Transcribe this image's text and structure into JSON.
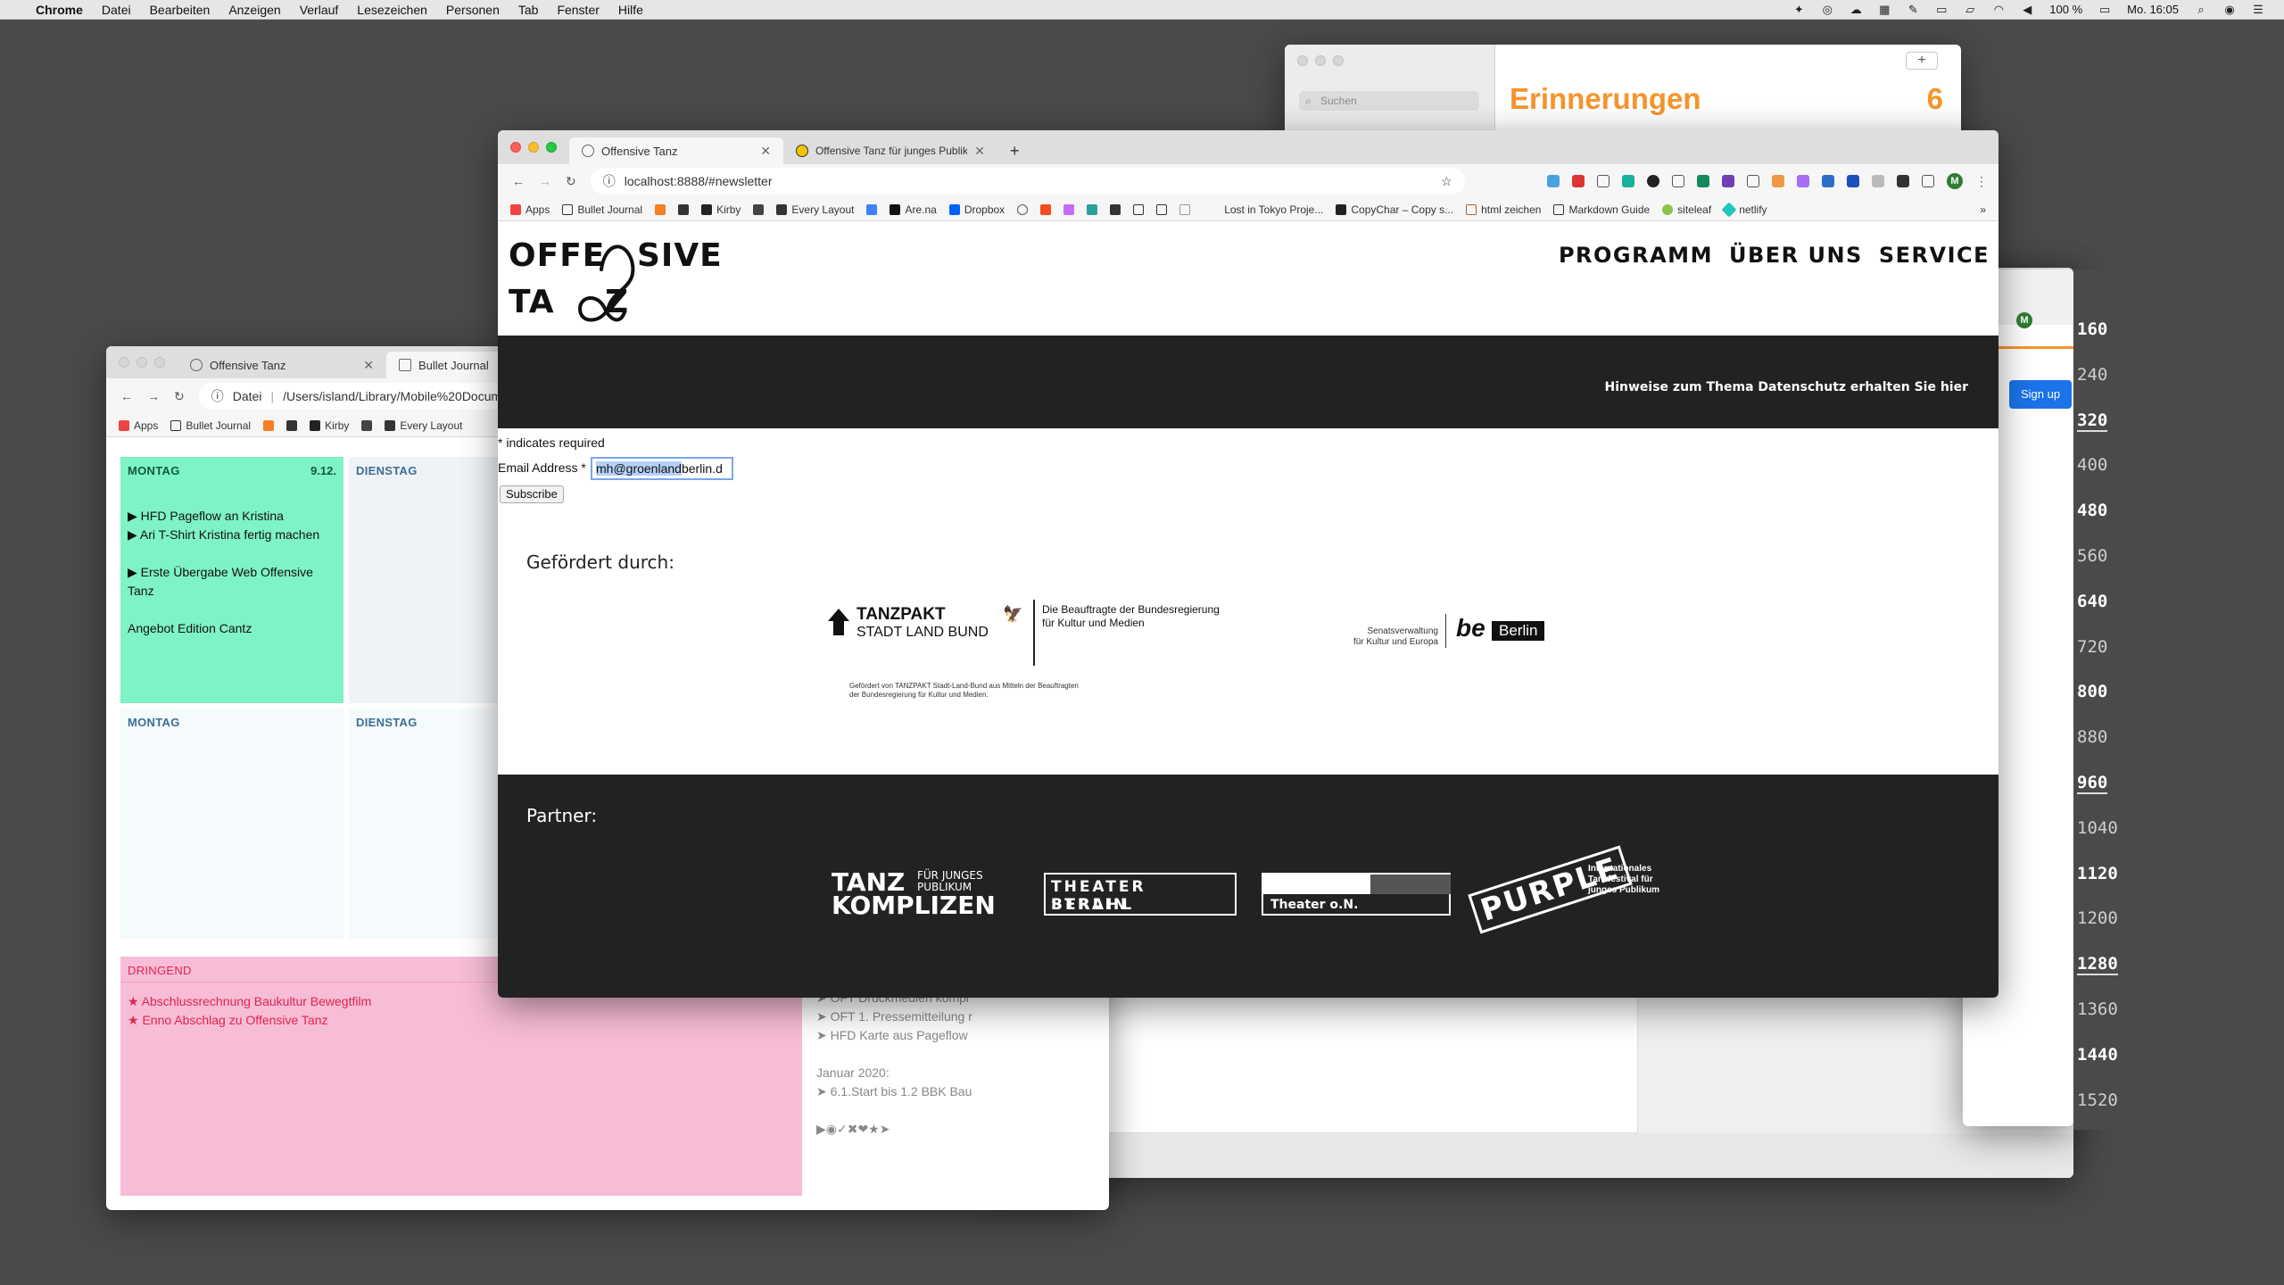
{
  "menubar": {
    "app": "Chrome",
    "items": [
      "Datei",
      "Bearbeiten",
      "Anzeigen",
      "Verlauf",
      "Lesezeichen",
      "Personen",
      "Tab",
      "Fenster",
      "Hilfe"
    ],
    "battery": "100 %",
    "clock": "Mo. 16:05"
  },
  "reminders": {
    "search_placeholder": "Suchen",
    "title": "Erinnerungen",
    "count": "6",
    "add_label": "+"
  },
  "ruler": {
    "values": [
      "160",
      "240",
      "320",
      "400",
      "480",
      "560",
      "640",
      "720",
      "800",
      "880",
      "960",
      "1040",
      "1120",
      "1200",
      "1280",
      "1360",
      "1440",
      "1520"
    ]
  },
  "signup": {
    "label": "Sign up"
  },
  "bj_window": {
    "tabs": [
      {
        "label": "Offensive Tanz"
      },
      {
        "label": "Bullet Journal"
      }
    ],
    "url_prefix": "Datei",
    "url": "/Users/island/Library/Mobile%20Docum",
    "bookmarks": [
      "Apps",
      "Bullet Journal",
      "Kirby",
      "Every Layout"
    ],
    "days": {
      "mon1": {
        "head": "MONTAG",
        "date": "9.12.",
        "items": [
          "▶ HFD Pageflow an Kristina",
          "▶ Ari T-Shirt Kristina fertig machen",
          "",
          "▶ Erste Übergabe Web Offensive Tanz",
          "",
          "Angebot Edition Cantz"
        ]
      },
      "die1": {
        "head": "DIENSTAG"
      },
      "mon2": {
        "head": "MONTAG"
      },
      "die2": {
        "head": "DIENSTAG"
      },
      "dringend": {
        "head": "DRINGEND",
        "items": [
          "★ Abschlussrechnung Baukultur Bewegtfilm",
          "★ Enno Abschlag zu Offensive Tanz"
        ]
      }
    },
    "misc_lines": [
      "➤ OFT Druckmedien kompl",
      "➤ OFT 1. Pressemitteilung r",
      "➤ HFD Karte aus Pageflow",
      "",
      "Januar 2020:",
      "➤ 6.1.Start bis 1.2 BBK Bau",
      "",
      "▶◉✓✖❤★➤"
    ]
  },
  "main_window": {
    "tabs": [
      {
        "label": "Offensive Tanz"
      },
      {
        "label": "Offensive Tanz für junges Publik"
      }
    ],
    "new_tab": "+",
    "url": "localhost:8888/#newsletter",
    "bookmarks": [
      "Apps",
      "Bullet Journal",
      "Kirby",
      "Every Layout",
      "Are.na",
      "Dropbox",
      "Lost in Tokyo Proje...",
      "CopyChar – Copy s...",
      "html zeichen",
      "Markdown Guide",
      "siteleaf",
      "netlify"
    ],
    "avatar": "M",
    "page": {
      "logo": {
        "line1a": "OFFE",
        "line1b": "SIVE",
        "line2a": "TA",
        "line2b": "Z"
      },
      "nav": [
        "PROGRAMM",
        "ÜBER UNS",
        "SERVICE"
      ],
      "privacy": "Hinweise zum Thema Datenschutz erhalten Sie hier",
      "form": {
        "required_note": "* indicates required",
        "email_label": "Email Address *",
        "email_selected": "mh@groenland",
        "email_rest": "berlin.d",
        "subscribe": "Subscribe"
      },
      "funded_heading": "Gefördert durch:",
      "funders": {
        "tanzpakt": "TANZPAKT",
        "tanzpakt_sub": "STADT LAND BUND",
        "bkm_line1": "Die Beauftragte der Bundesregierung",
        "bkm_line2": "für Kultur und Medien",
        "fine1": "Gefördert von TANZPAKT Stadt-Land-Bund aus Mitteln der Beauftragten",
        "fine2": "der Bundesregierung für Kultur und Medien.",
        "senat1": "Senatsverwaltung",
        "senat2": "für Kultur und Europa",
        "be": "be",
        "berlin": "Berlin"
      },
      "partners_heading": "Partner:",
      "partners": {
        "tanz": "TANZ",
        "fuer": "FÜR JUNGES",
        "publikum": "PUBLIKUM",
        "komplizen": "KOMPLIZEN",
        "strahl1": "THEATER STRAHL",
        "strahl2": "BERLIN",
        "theater_on": "Theater o.N.",
        "purple": "PURPLE",
        "purple_sub1": "Internationales",
        "purple_sub2": "Tanzfestival für",
        "purple_sub3": "junges Publikum"
      }
    }
  }
}
